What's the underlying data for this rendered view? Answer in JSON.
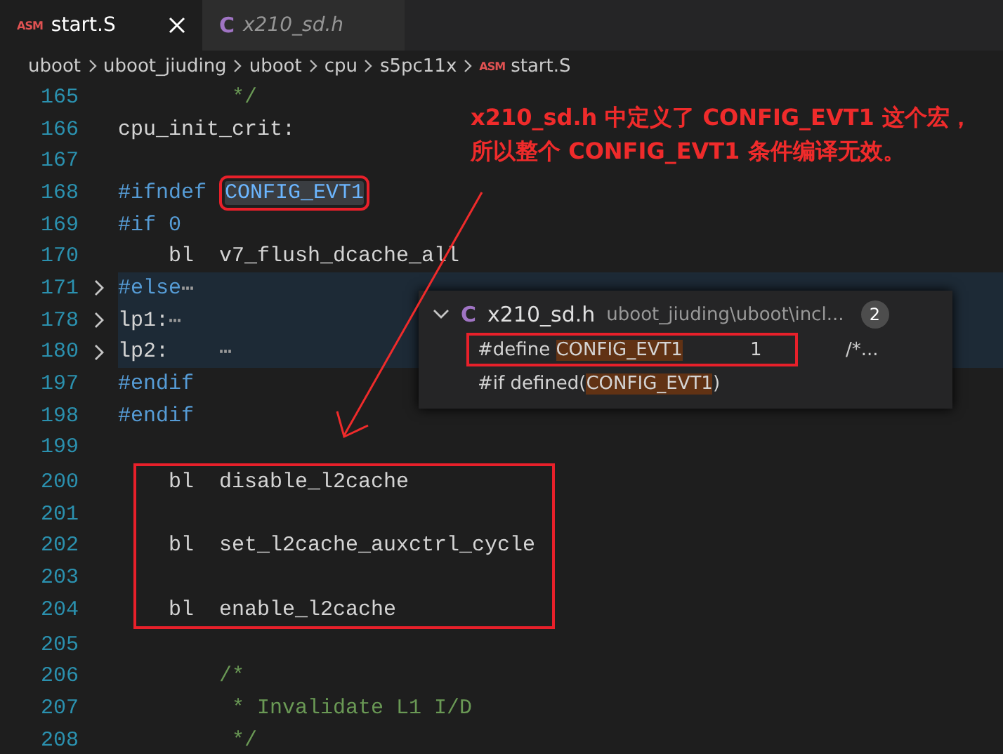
{
  "tabs": [
    {
      "icon": "ASM",
      "kind": "asm",
      "label": "start.S",
      "selected": true,
      "preview": false
    },
    {
      "icon": "C",
      "kind": "c",
      "label": "x210_sd.h",
      "selected": false,
      "preview": true
    }
  ],
  "breadcrumb": [
    {
      "label": "uboot"
    },
    {
      "label": "uboot_jiuding"
    },
    {
      "label": "uboot"
    },
    {
      "label": "cpu"
    },
    {
      "label": "s5pc11x"
    },
    {
      "label": "start.S",
      "icon": "ASM"
    }
  ],
  "code": {
    "lines": [
      {
        "number": "165",
        "kind": "normal",
        "segments": [
          {
            "text": "         */",
            "kind": "comment"
          }
        ]
      },
      {
        "number": "166",
        "kind": "normal",
        "segments": [
          {
            "text": "cpu_init_crit:",
            "kind": "text"
          }
        ]
      },
      {
        "number": "167",
        "kind": "normal"
      },
      {
        "number": "168",
        "kind": "normal",
        "segments": [
          {
            "text": "#ifndef ",
            "kind": "keyword"
          },
          {
            "text": "CONFIG_EVT1",
            "kind": "selected-word",
            "boxed": true
          }
        ]
      },
      {
        "number": "169",
        "kind": "normal",
        "segments": [
          {
            "text": "#if 0",
            "kind": "keyword"
          }
        ]
      },
      {
        "number": "170",
        "kind": "normal",
        "segments": [
          {
            "text": "    bl  v7_flush_dcache_all",
            "kind": "text"
          }
        ]
      },
      {
        "number": "171",
        "kind": "folded",
        "segments": [
          {
            "text": "#else",
            "kind": "keyword"
          },
          {
            "text": "⋯",
            "kind": "ellipsis"
          }
        ]
      },
      {
        "number": "178",
        "kind": "folded",
        "segments": [
          {
            "text": "lp1:",
            "kind": "text"
          },
          {
            "text": "⋯",
            "kind": "ellipsis"
          }
        ]
      },
      {
        "number": "180",
        "kind": "folded",
        "segments": [
          {
            "text": "lp2:    ",
            "kind": "text"
          },
          {
            "text": "⋯",
            "kind": "ellipsis"
          }
        ]
      },
      {
        "number": "197",
        "kind": "normal",
        "segments": [
          {
            "text": "#endif",
            "kind": "keyword"
          }
        ]
      },
      {
        "number": "198",
        "kind": "normal",
        "segments": [
          {
            "text": "#endif",
            "kind": "keyword"
          }
        ]
      },
      {
        "number": "199",
        "kind": "normal"
      },
      {
        "number": "200",
        "kind": "normal",
        "boxed": true,
        "segments": [
          {
            "text": "    bl  disable_l2cache",
            "kind": "text"
          }
        ]
      },
      {
        "number": "201",
        "kind": "normal",
        "boxed": true
      },
      {
        "number": "202",
        "kind": "normal",
        "boxed": true,
        "segments": [
          {
            "text": "    bl  set_l2cache_auxctrl_cycle",
            "kind": "text"
          }
        ]
      },
      {
        "number": "203",
        "kind": "normal",
        "boxed": true
      },
      {
        "number": "204",
        "kind": "normal",
        "boxed": true,
        "segments": [
          {
            "text": "    bl  enable_l2cache",
            "kind": "text"
          }
        ]
      },
      {
        "number": "205",
        "kind": "normal"
      },
      {
        "number": "206",
        "kind": "normal",
        "segments": [
          {
            "text": "        /*",
            "kind": "comment"
          }
        ]
      },
      {
        "number": "207",
        "kind": "normal",
        "segments": [
          {
            "text": "         * Invalidate L1 I/D",
            "kind": "comment"
          }
        ]
      },
      {
        "number": "208",
        "kind": "normal",
        "segments": [
          {
            "text": "         */",
            "kind": "comment"
          }
        ]
      }
    ]
  },
  "peek": {
    "expanded": true,
    "icon": "C",
    "file": "x210_sd.h",
    "path": "uboot_jiuding\\uboot\\incl...",
    "count": "2",
    "results": [
      {
        "boxed": true,
        "segments": [
          {
            "text": "#define ",
            "kind": "text"
          },
          {
            "text": "CONFIG_EVT1",
            "kind": "match"
          },
          {
            "text": "1",
            "kind": "value"
          },
          {
            "text": "/*...",
            "kind": "comment"
          }
        ]
      },
      {
        "boxed": false,
        "segments": [
          {
            "text": "#if defined(",
            "kind": "text"
          },
          {
            "text": "CONFIG_EVT1",
            "kind": "match"
          },
          {
            "text": ")",
            "kind": "text"
          }
        ]
      }
    ]
  },
  "annotation": {
    "lines": [
      "x210_sd.h 中定义了 CONFIG_EVT1 这个宏，",
      "所以整个 CONFIG_EVT1 条件编译无效。"
    ]
  }
}
